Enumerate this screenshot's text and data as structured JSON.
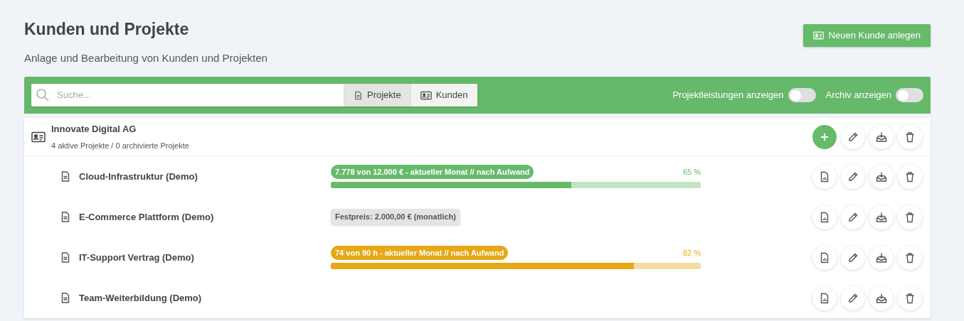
{
  "header": {
    "title": "Kunden und Projekte",
    "subtitle": "Anlage und Bearbeitung von Kunden und Projekten",
    "button": "Neuen Kunde anlegen"
  },
  "toolbar": {
    "search": {
      "placeholder": "Suche..."
    },
    "tabs": [
      {
        "label": "Projekte",
        "kind": "file",
        "selected": true
      },
      {
        "label": "Kunden",
        "kind": "card",
        "selected": false
      }
    ],
    "toggles": [
      {
        "label": "Projektleistungen anzeigen",
        "on": false
      },
      {
        "label": "Archiv anzeigen",
        "on": false
      }
    ]
  },
  "customer": {
    "name": "Innovate Digital AG",
    "summary": "4 aktive Projekte / 0 archivierte Projekte"
  },
  "projects": [
    {
      "name": "Cloud-Infrastruktur (Demo)",
      "kind": "progress",
      "label": "7.778 von 12.000 € - aktueller Monat // nach Aufwand",
      "percent": "65 %",
      "level": 0.65,
      "color": "#66bb6a"
    },
    {
      "name": "E-Commerce Plattform (Demo)",
      "kind": "fixed",
      "label": "Festpreis: 2.000,00 € (monatlich)"
    },
    {
      "name": "IT-Support Vertrag (Demo)",
      "kind": "progress",
      "label": "74 von 90 h - aktueller Monat // nach Aufwand",
      "percent": "82 %",
      "level": 0.82,
      "color": "#e6a817"
    },
    {
      "name": "Team-Weiterbildung (Demo)",
      "kind": "none"
    }
  ]
}
